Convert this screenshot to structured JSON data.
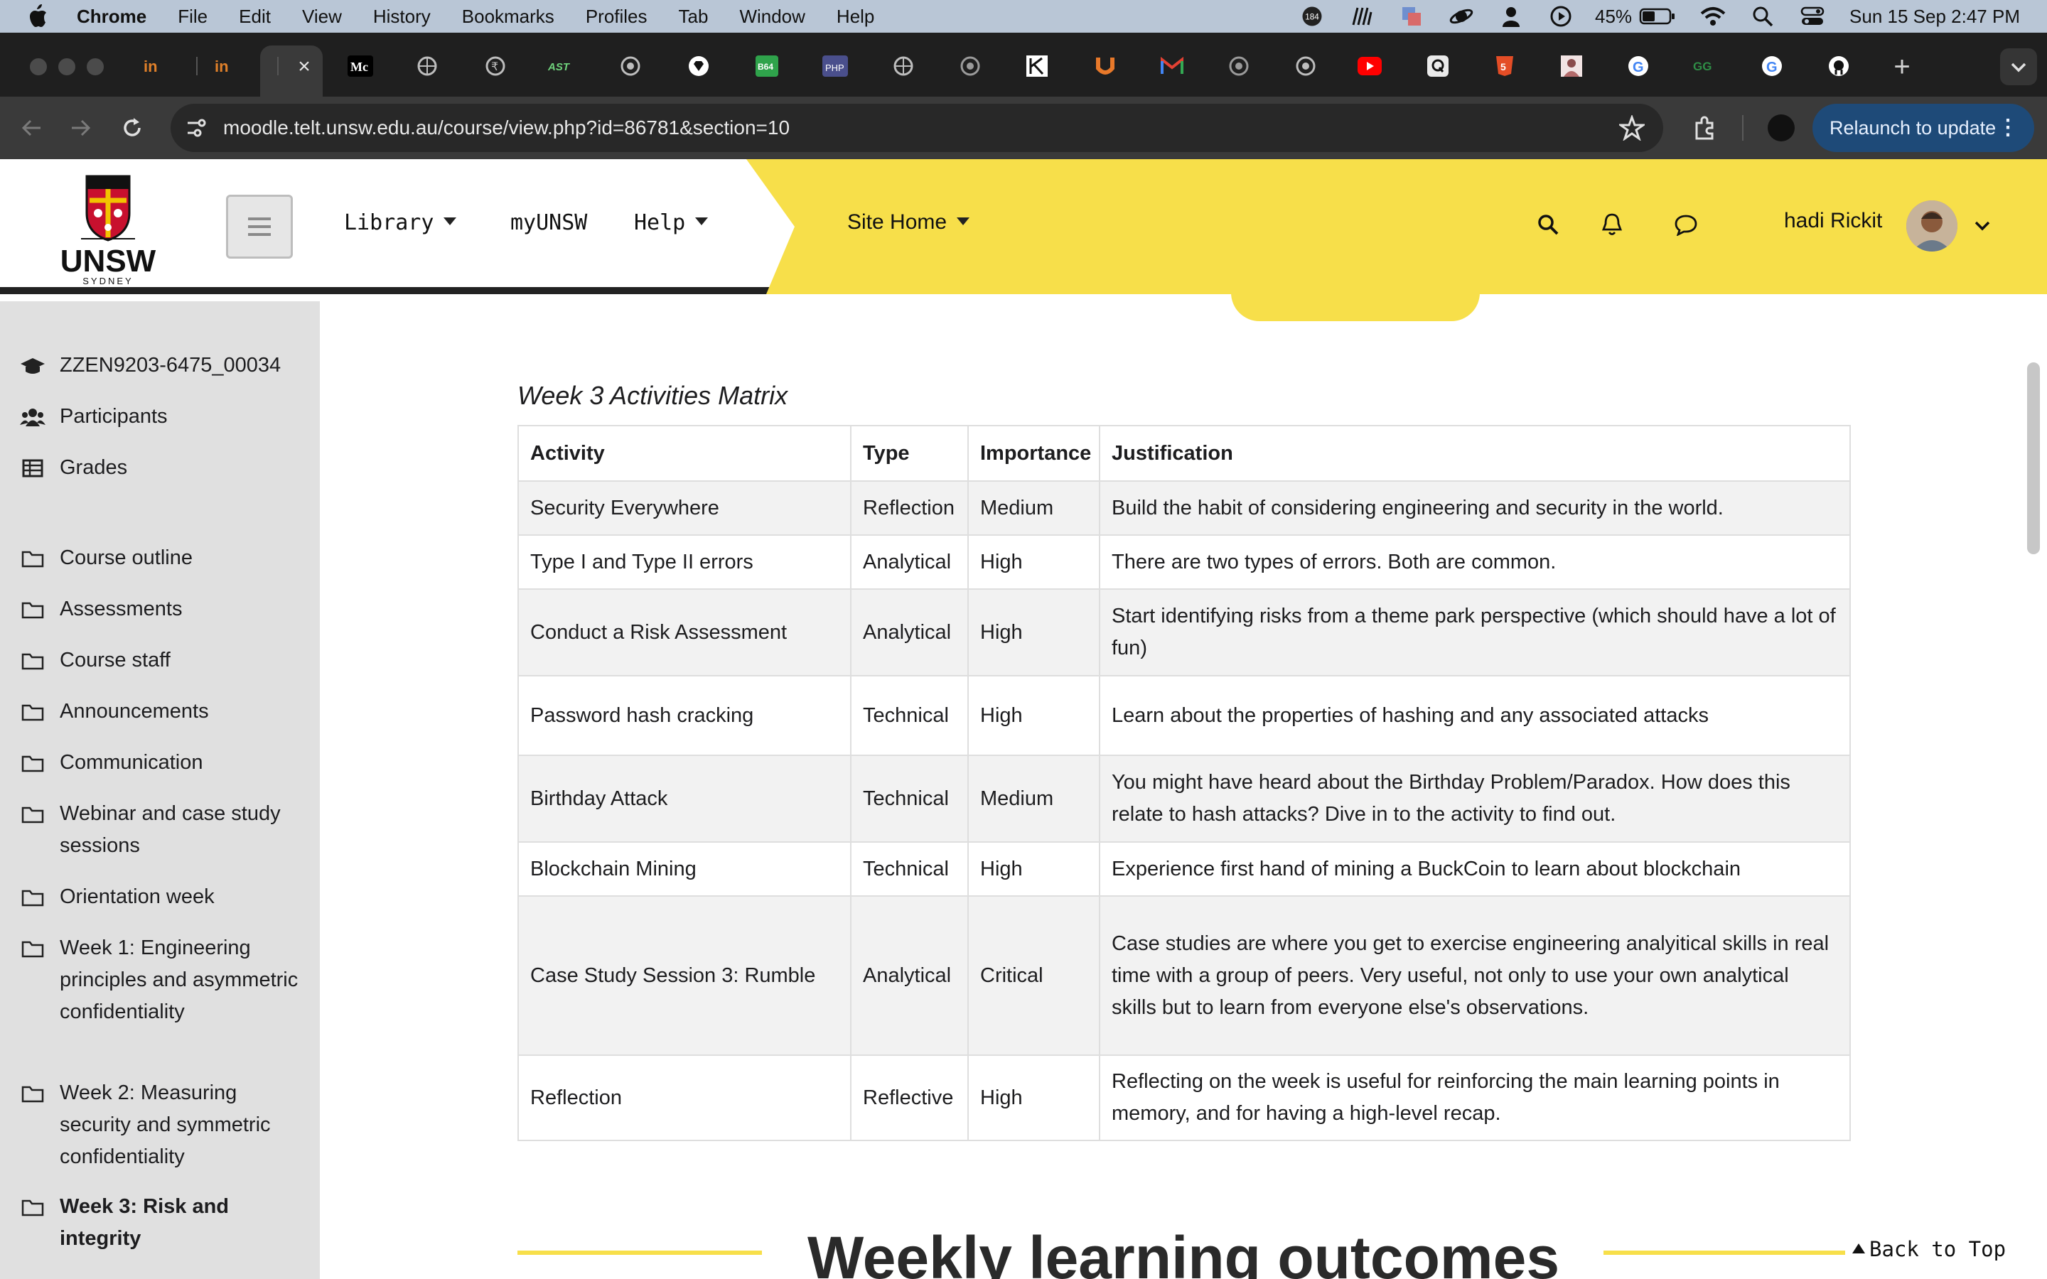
{
  "menubar": {
    "app": "Chrome",
    "items": [
      "File",
      "Edit",
      "View",
      "History",
      "Bookmarks",
      "Profiles",
      "Tab",
      "Window",
      "Help"
    ],
    "badge_count": "184",
    "battery": "45%",
    "clock": "Sun 15 Sep  2:47 PM"
  },
  "browser": {
    "tab_favicons": [
      "in",
      "in",
      "Mc",
      "globe",
      "rupee-globe",
      "AST",
      "target",
      "diamond",
      "B64",
      "PHP",
      "globe",
      "target",
      "k-logo",
      "u-logo",
      "gmail",
      "target",
      "target",
      "youtube",
      "q-logo",
      "html5",
      "photo",
      "google",
      "gg",
      "google",
      "github"
    ],
    "url": "moodle.telt.unsw.edu.au/course/view.php?id=86781&section=10",
    "relaunch_label": "Relaunch to update"
  },
  "header": {
    "logo_text": "UNSW",
    "logo_subtext": "SYDNEY",
    "nav": [
      "Library",
      "myUNSW",
      "Help"
    ],
    "site_home": "Site Home",
    "user_name": "hadi Rickit"
  },
  "drawer": {
    "top_items": [
      {
        "label": "ZZEN9203-6475_00034",
        "icon": "graduation-cap-icon"
      },
      {
        "label": "Participants",
        "icon": "users-icon"
      },
      {
        "label": "Grades",
        "icon": "table-icon"
      }
    ],
    "sections": [
      {
        "label": "Course outline"
      },
      {
        "label": "Assessments"
      },
      {
        "label": "Course staff"
      },
      {
        "label": "Announcements"
      },
      {
        "label": "Communication"
      },
      {
        "label": "Webinar and case study sessions"
      },
      {
        "label": "Orientation week"
      },
      {
        "label": "Week 1: Engineering principles and asymmetric confidentiality"
      },
      {
        "label": "Week 2: Measuring security and symmetric confidentiality"
      },
      {
        "label": "Week 3: Risk and integrity"
      }
    ]
  },
  "matrix": {
    "caption": "Week 3 Activities Matrix",
    "headers": [
      "Activity",
      "Type",
      "Importance",
      "Justification"
    ],
    "rows": [
      [
        "Security Everywhere",
        "Reflection",
        "Medium",
        "Build the habit of considering engineering and security in the world."
      ],
      [
        "Type I and Type II errors",
        "Analytical",
        "High",
        "There are two types of errors. Both are common."
      ],
      [
        "Conduct a Risk Assessment",
        "Analytical",
        "High",
        "Start identifying risks from a theme park perspective (which should have a lot of fun)"
      ],
      [
        "Password hash cracking",
        "Technical",
        "High",
        "Learn about the properties of hashing and any associated attacks"
      ],
      [
        "Birthday Attack",
        "Technical",
        "Medium",
        "You might have heard about the Birthday Problem/Paradox. How does this relate to hash attacks? Dive in to the activity to find out."
      ],
      [
        "Blockchain Mining",
        "Technical",
        "High",
        "Experience first hand of mining a BuckCoin to learn about blockchain"
      ],
      [
        "Case Study Session 3: Rumble",
        "Analytical",
        "Critical",
        "Case studies are where you get to exercise engineering analyitical skills in real time with a group of peers. Very useful, not only to use your own analytical skills but to learn from everyone else's observations."
      ],
      [
        "Reflection",
        "Reflective",
        "High",
        "Reflecting on the week is useful for reinforcing the main learning points in memory, and for having a high-level recap."
      ]
    ]
  },
  "outcomes_heading": "Weekly learning outcomes",
  "back_to_top": "Back to Top",
  "colors": {
    "accent_yellow": "#f7df4a",
    "drawer_bg": "#e0e0e0",
    "relaunch_bg": "#1e4a78"
  }
}
